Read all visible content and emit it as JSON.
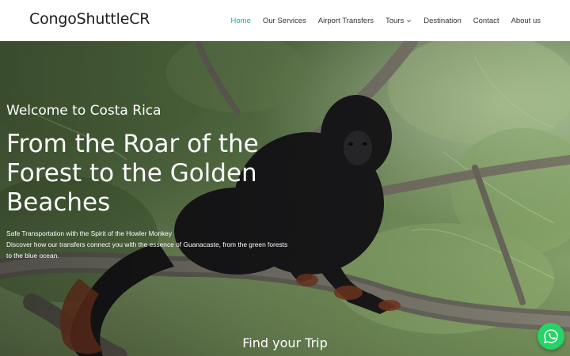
{
  "header": {
    "logo": "CongoShuttleCR",
    "nav": [
      {
        "label": "Home",
        "active": true
      },
      {
        "label": "Our Services"
      },
      {
        "label": "Airport Transfers"
      },
      {
        "label": "Tours",
        "dropdown": true
      },
      {
        "label": "Destination"
      },
      {
        "label": "Contact"
      },
      {
        "label": "About us"
      }
    ]
  },
  "hero": {
    "welcome": "Welcome to Costa Rica",
    "headline": "From the Roar of the Forest to the Golden Beaches",
    "sub_line1": "Safe Transportation with the Spirit of the Howler Monkey",
    "sub_line2": "Discover how our transfers connect you with the essence of Guanacaste, from the green forests to the blue ocean.",
    "find_trip": "Find your Trip"
  },
  "colors": {
    "accent": "#1aa7a6",
    "whatsapp": "#25d366"
  },
  "icons": {
    "chevron": "chevron-down-icon",
    "whatsapp": "whatsapp-icon"
  }
}
